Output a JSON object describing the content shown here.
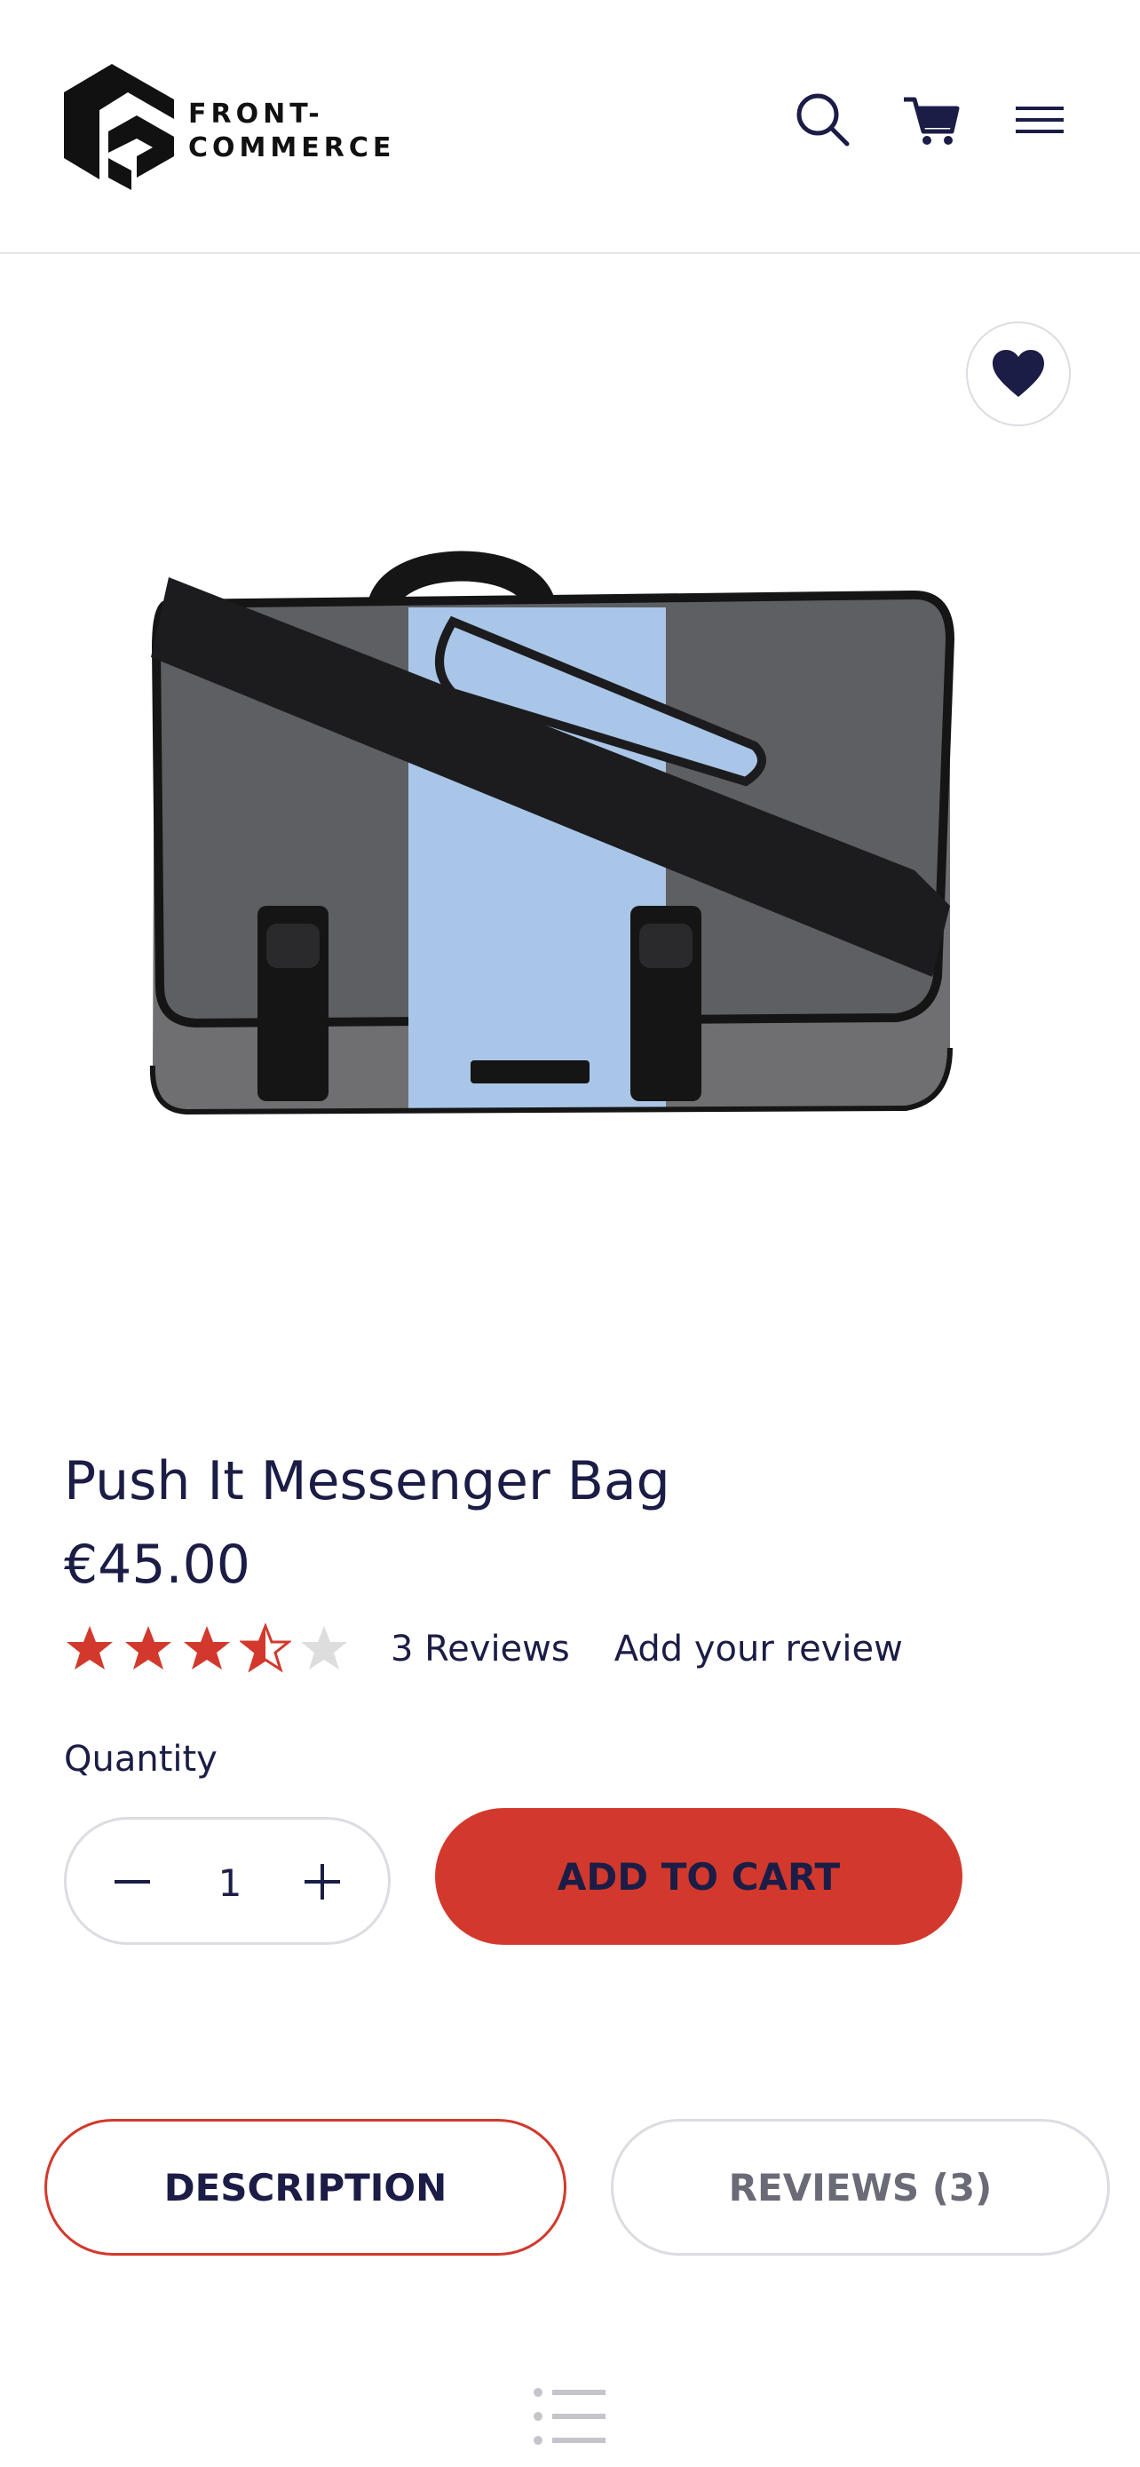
{
  "header": {
    "logo_line1": "FRONT-",
    "logo_line2": "COMMERCE",
    "icons": [
      "search-icon",
      "cart-icon",
      "menu-icon"
    ]
  },
  "product": {
    "title": "Push It Messenger Bag",
    "price": "€45.00",
    "rating": 3.5,
    "rating_max": 5,
    "reviews_link": "3 Reviews",
    "add_review": "Add your review",
    "quantity_label": "Quantity",
    "quantity": "1",
    "add_to_cart": "ADD TO CART"
  },
  "tabs": [
    {
      "label": "DESCRIPTION",
      "active": true
    },
    {
      "label": "REVIEWS (3)",
      "active": false
    }
  ],
  "colors": {
    "accent": "#d2392c",
    "text": "#1b1d46",
    "border": "#dcdce2",
    "star_empty": "#dddddd"
  }
}
